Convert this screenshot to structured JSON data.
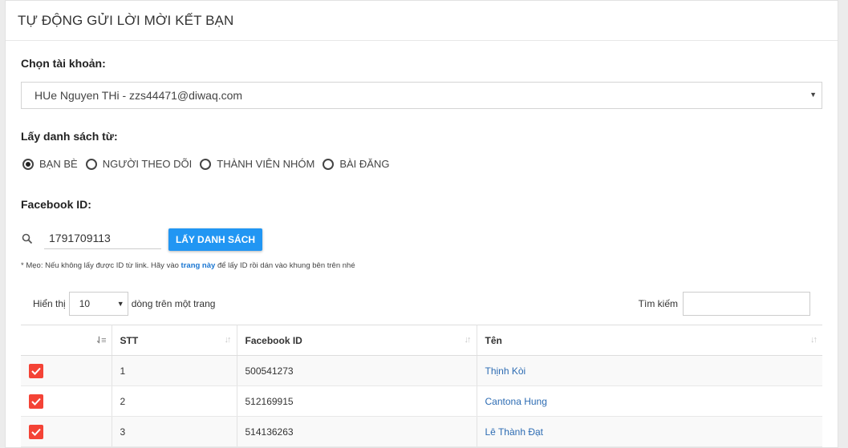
{
  "header": {
    "title": "TỰ ĐỘNG GỬI LỜI MỜI KẾT BẠN"
  },
  "account": {
    "label": "Chọn tài khoản:",
    "selected": "HUe Nguyen THi - zzs44471@diwaq.com"
  },
  "source": {
    "label": "Lấy danh sách từ:",
    "options": [
      {
        "label": "BẠN BÈ",
        "selected": true
      },
      {
        "label": "NGƯỜI THEO DÕI",
        "selected": false
      },
      {
        "label": "THÀNH VIÊN NHÓM",
        "selected": false
      },
      {
        "label": "BÀI ĐĂNG",
        "selected": false
      }
    ]
  },
  "facebook": {
    "label": "Facebook ID:",
    "value": "1791709113",
    "button": "LẤY DANH SÁCH"
  },
  "tip": {
    "before": "* Mẹo: Nếu không lấy được ID từ link. Hãy vào",
    "link": "trang này",
    "after": "để lấy ID rồi dán vào khung bên trên nhé"
  },
  "table_controls": {
    "show_label": "Hiển thị",
    "page_size": "10",
    "per_page_label": "dòng trên một trang",
    "search_label": "Tìm kiếm"
  },
  "table": {
    "headers": [
      "",
      "STT",
      "Facebook ID",
      "Tên"
    ],
    "rows": [
      {
        "checked": true,
        "stt": "1",
        "fbid": "500541273",
        "name": "Thịnh Kòi"
      },
      {
        "checked": true,
        "stt": "2",
        "fbid": "512169915",
        "name": "Cantona Hung"
      },
      {
        "checked": true,
        "stt": "3",
        "fbid": "514136263",
        "name": "Lê Thành Đạt"
      }
    ]
  },
  "colors": {
    "accent": "#2196f3",
    "checkbox": "#f44336",
    "link": "#2d6cb3"
  }
}
